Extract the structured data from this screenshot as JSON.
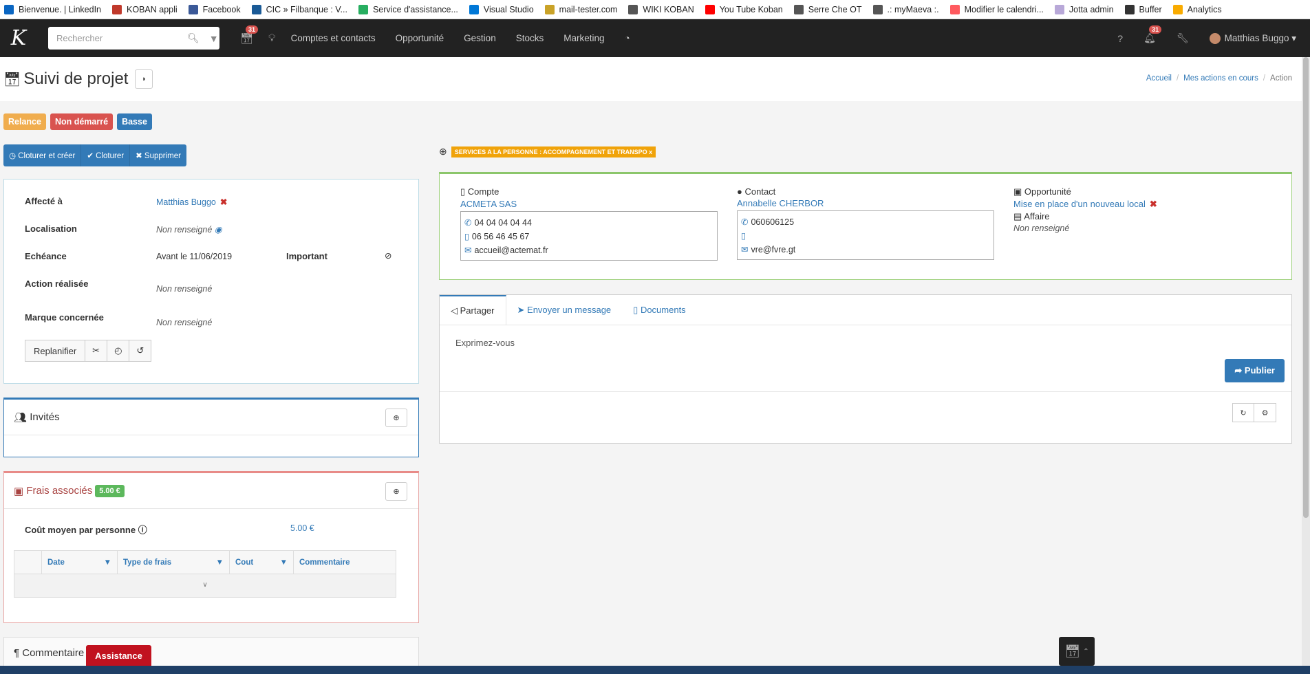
{
  "bookmarks": [
    {
      "label": "Bienvenue. | LinkedIn",
      "color": "#0a66c2"
    },
    {
      "label": "KOBAN appli",
      "color": "#c0392b"
    },
    {
      "label": "Facebook",
      "color": "#3b5998"
    },
    {
      "label": "CIC » Filbanque : V...",
      "color": "#1a5a96"
    },
    {
      "label": "Service d'assistance...",
      "color": "#27ae60"
    },
    {
      "label": "Visual Studio",
      "color": "#0078d7"
    },
    {
      "label": "mail-tester.com",
      "color": "#c9a227"
    },
    {
      "label": "WIKI KOBAN",
      "color": "#555555"
    },
    {
      "label": "You Tube Koban",
      "color": "#ff0000"
    },
    {
      "label": "Serre Che OT",
      "color": "#555555"
    },
    {
      "label": ".: myMaeva :.",
      "color": "#555555"
    },
    {
      "label": "Modifier le calendri...",
      "color": "#ff5a5f"
    },
    {
      "label": "Jotta admin",
      "color": "#b8a8d8"
    },
    {
      "label": "Buffer",
      "color": "#333333"
    },
    {
      "label": "Analytics",
      "color": "#f9ab00"
    }
  ],
  "navbar": {
    "search_placeholder": "Rechercher",
    "calendar_badge": "31",
    "links": [
      "Comptes et contacts",
      "Opportunité",
      "Gestion",
      "Stocks",
      "Marketing"
    ],
    "notif_badge": "31",
    "user_name": "Matthias Buggo"
  },
  "page": {
    "title": "Suivi de projet",
    "breadcrumb": [
      "Accueil",
      "Mes actions en cours",
      "Action"
    ]
  },
  "labels": [
    {
      "text": "Relance",
      "color": "#f0ad4e"
    },
    {
      "text": "Non démarré",
      "color": "#d9534f"
    },
    {
      "text": "Basse",
      "color": "#337ab7"
    }
  ],
  "actions": {
    "close_create": "Cloturer et créer",
    "close": "Cloturer",
    "delete": "Supprimer"
  },
  "details": {
    "assigned_label": "Affecté à",
    "assigned_value": "Matthias Buggo",
    "location_label": "Localisation",
    "location_value": "Non renseigné",
    "due_label": "Echéance",
    "due_value": "Avant le 11/06/2019",
    "important_label": "Important",
    "done_label": "Action réalisée",
    "done_value": "Non renseigné",
    "brand_label": "Marque concernée",
    "brand_value": "Non renseigné",
    "reschedule": "Replanifier"
  },
  "invites": {
    "title": "Invités"
  },
  "frais": {
    "title": "Frais associés",
    "total": "5.00 €",
    "avg_label": "Coût moyen par personne",
    "avg_value": "5.00 €",
    "columns": [
      "Date",
      "Type de frais",
      "Cout",
      "Commentaire"
    ]
  },
  "comment": {
    "title": "Commentaire"
  },
  "tag": {
    "text": "SERVICES A LA PERSONNE : ACCOMPAGNEMENT ET TRANSPO x"
  },
  "compte": {
    "label": "Compte",
    "name": "ACMETA SAS",
    "phone1": "04 04 04 04 44",
    "phone2": "06 56 46 45 67",
    "email": "accueil@actemat.fr"
  },
  "contact": {
    "label": "Contact",
    "name": "Annabelle CHERBOR",
    "phone1": "060606125",
    "phone2": "",
    "email": "vre@fvre.gt"
  },
  "opportunite": {
    "label": "Opportunité",
    "name": "Mise en place d'un nouveau local",
    "affaire_label": "Affaire",
    "affaire_value": "Non renseigné"
  },
  "tabs": {
    "share": "Partager",
    "message": "Envoyer un message",
    "documents": "Documents",
    "prompt": "Exprimez-vous",
    "publish": "Publier"
  },
  "assist": "Assistance"
}
